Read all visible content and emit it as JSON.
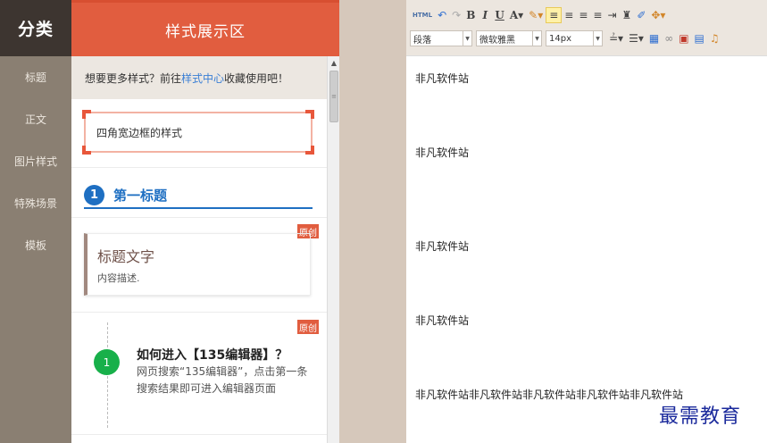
{
  "sidebar": {
    "header": "分类",
    "items": [
      {
        "label": "标题"
      },
      {
        "label": "正文"
      },
      {
        "label": "图片样式"
      },
      {
        "label": "特殊场景"
      },
      {
        "label": "模板"
      }
    ]
  },
  "panel": {
    "header": "样式展示区",
    "notice_prefix": "想要更多样式？前往",
    "notice_link": "样式中心",
    "notice_suffix": "收藏使用吧！",
    "corner_box_text": "四角宽边框的样式",
    "heading1_num": "1",
    "heading1_text": "第一标题",
    "orig_badge": "原创",
    "title_card_title": "标题文字",
    "title_card_desc": "内容描述.",
    "step_num": "1",
    "step_title": "如何进入【135编辑器】？",
    "step_desc": "网页搜索“135编辑器”，点击第一条搜索结果即可进入编辑器页面"
  },
  "toolbar": {
    "row1": [
      {
        "name": "html-icon",
        "glyph": "HTML"
      },
      {
        "name": "undo-icon",
        "glyph": "↶"
      },
      {
        "name": "redo-icon",
        "glyph": "↷"
      },
      {
        "name": "bold-button",
        "glyph": "B"
      },
      {
        "name": "italic-button",
        "glyph": "I"
      },
      {
        "name": "underline-button",
        "glyph": "U"
      },
      {
        "name": "font-color-button",
        "glyph": "A▾"
      },
      {
        "name": "highlight-button",
        "glyph": "✎▾"
      },
      {
        "name": "align-left-icon",
        "glyph": "≡"
      },
      {
        "name": "align-center-icon",
        "glyph": "≡"
      },
      {
        "name": "align-right-icon",
        "glyph": "≡"
      },
      {
        "name": "align-justify-icon",
        "glyph": "≡"
      },
      {
        "name": "indent-icon",
        "glyph": "⇥"
      },
      {
        "name": "find-icon",
        "glyph": "♜"
      },
      {
        "name": "eraser-icon",
        "glyph": "✐"
      },
      {
        "name": "format-painter-icon",
        "glyph": "✥▾"
      }
    ],
    "paragraph_select": "段落",
    "font_select": "微软雅黑",
    "size_select": "14px",
    "row2": [
      {
        "name": "line-height-icon",
        "glyph": "≟▾"
      },
      {
        "name": "list-icon",
        "glyph": "☰▾"
      },
      {
        "name": "table-icon",
        "glyph": "▦"
      },
      {
        "name": "link-icon",
        "glyph": "∞"
      },
      {
        "name": "image-icon",
        "glyph": "▣"
      },
      {
        "name": "save-icon",
        "glyph": "▤"
      },
      {
        "name": "music-icon",
        "glyph": "♫"
      }
    ]
  },
  "editor": {
    "paragraphs": [
      "非凡软件站",
      "非凡软件站",
      "非凡软件站",
      "非凡软件站",
      "非凡软件站非凡软件站非凡软件站非凡软件站非凡软件站"
    ]
  },
  "watermark": "最需教育"
}
